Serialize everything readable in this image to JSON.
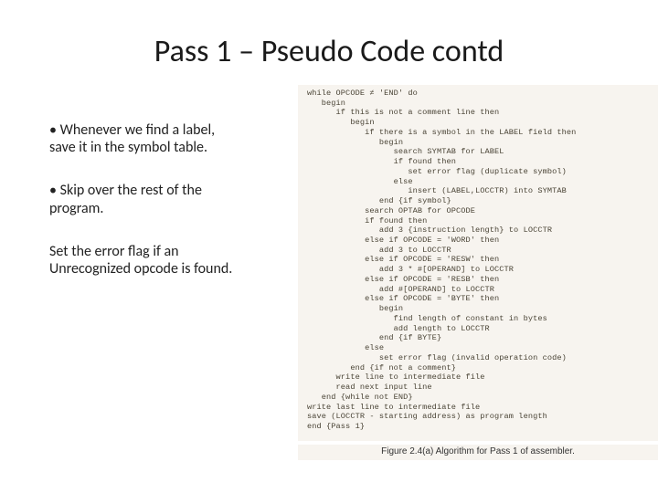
{
  "title": "Pass 1 – Pseudo Code contd",
  "left": {
    "b1_line1": "Whenever we find a label,",
    "b1_line2": " save it in the symbol table.",
    "b2_line1": "Skip over the rest of the",
    "b2_line2": "program.",
    "b3_line1": "Set the error flag if an",
    "b3_line2": "Unrecognized opcode is found."
  },
  "pseudocode": "while OPCODE ≠ 'END' do\n   begin\n      if this is not a comment line then\n         begin\n            if there is a symbol in the LABEL field then\n               begin\n                  search SYMTAB for LABEL\n                  if found then\n                     set error flag (duplicate symbol)\n                  else\n                     insert (LABEL,LOCCTR) into SYMTAB\n               end {if symbol}\n            search OPTAB for OPCODE\n            if found then\n               add 3 {instruction length} to LOCCTR\n            else if OPCODE = 'WORD' then\n               add 3 to LOCCTR\n            else if OPCODE = 'RESW' then\n               add 3 * #[OPERAND] to LOCCTR\n            else if OPCODE = 'RESB' then\n               add #[OPERAND] to LOCCTR\n            else if OPCODE = 'BYTE' then\n               begin\n                  find length of constant in bytes\n                  add length to LOCCTR\n               end {if BYTE}\n            else\n               set error flag (invalid operation code)\n         end {if not a comment}\n      write line to intermediate file\n      read next input line\n   end {while not END}\nwrite last line to intermediate file\nsave (LOCCTR - starting address) as program length\nend {Pass 1}",
  "figure_caption": "Figure 2.4(a)  Algorithm for Pass 1 of assembler."
}
